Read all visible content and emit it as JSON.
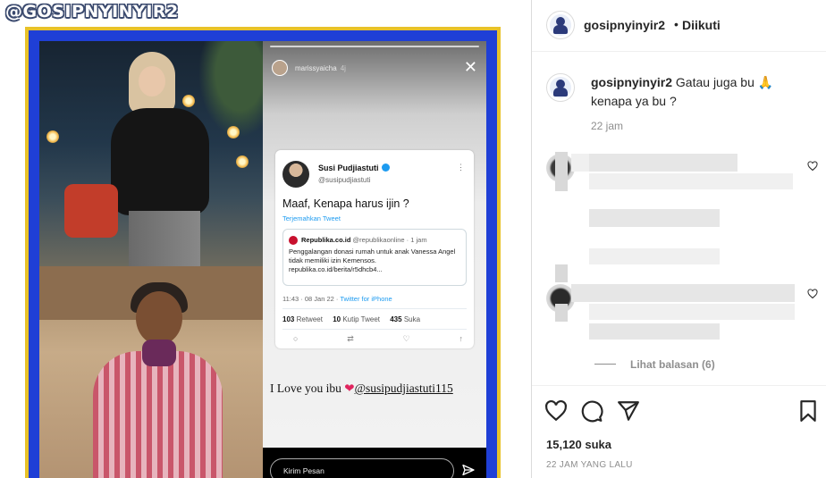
{
  "post": {
    "watermark": "@GOSIPNYINYIR2",
    "story": {
      "username": "marissyaicha",
      "time": "4j",
      "tweet": {
        "name": "Susi Pudjiastuti",
        "handle": "@susipudjiastuti",
        "text": "Maaf, Kenapa harus ijin ?",
        "translate": "Terjemahkan Tweet",
        "quote_source": "Republika.co.id",
        "quote_handle": "@republikaonline · 1 jam",
        "quote_body": "Penggalangan donasi rumah untuk anak Vanessa Angel tidak memiliki izin Kemensos. republika.co.id/berita/r5dhcb4...",
        "meta_time": "11:43 · 08 Jan 22 · ",
        "meta_client": "Twitter for iPhone",
        "retweets": "103",
        "retweets_label": "Retweet",
        "quotes": "10",
        "quotes_label": "Kutip Tweet",
        "likes": "435",
        "likes_label": "Suka"
      },
      "story_watermark": "@GOSIPNYINYIR2",
      "caption_text": "I Love you ibu ",
      "caption_mention": "@susipudjiastuti115",
      "reply_placeholder": "Kirim Pesan"
    }
  },
  "sidebar": {
    "header": {
      "username": "gosipnyinyir2",
      "dot": "•",
      "follow_state": "Diikuti"
    },
    "caption": {
      "username": "gosipnyinyir2",
      "text": "Gatau juga bu 🙏 kenapa ya bu ?",
      "time": "22 jam"
    },
    "view_replies": "Lihat balasan (6)",
    "likes": "15,120 suka",
    "date": "22 JAM YANG LALU"
  },
  "colors": {
    "frame_yellow": "#e8c229",
    "frame_blue": "#1f3fd6",
    "text_primary": "#262626",
    "text_secondary": "#8e8e8e",
    "link_blue": "#1d9bf0"
  },
  "icons": [
    "close-icon",
    "verified-icon",
    "send-icon",
    "heart-icon",
    "comment-icon",
    "share-icon",
    "bookmark-icon"
  ]
}
